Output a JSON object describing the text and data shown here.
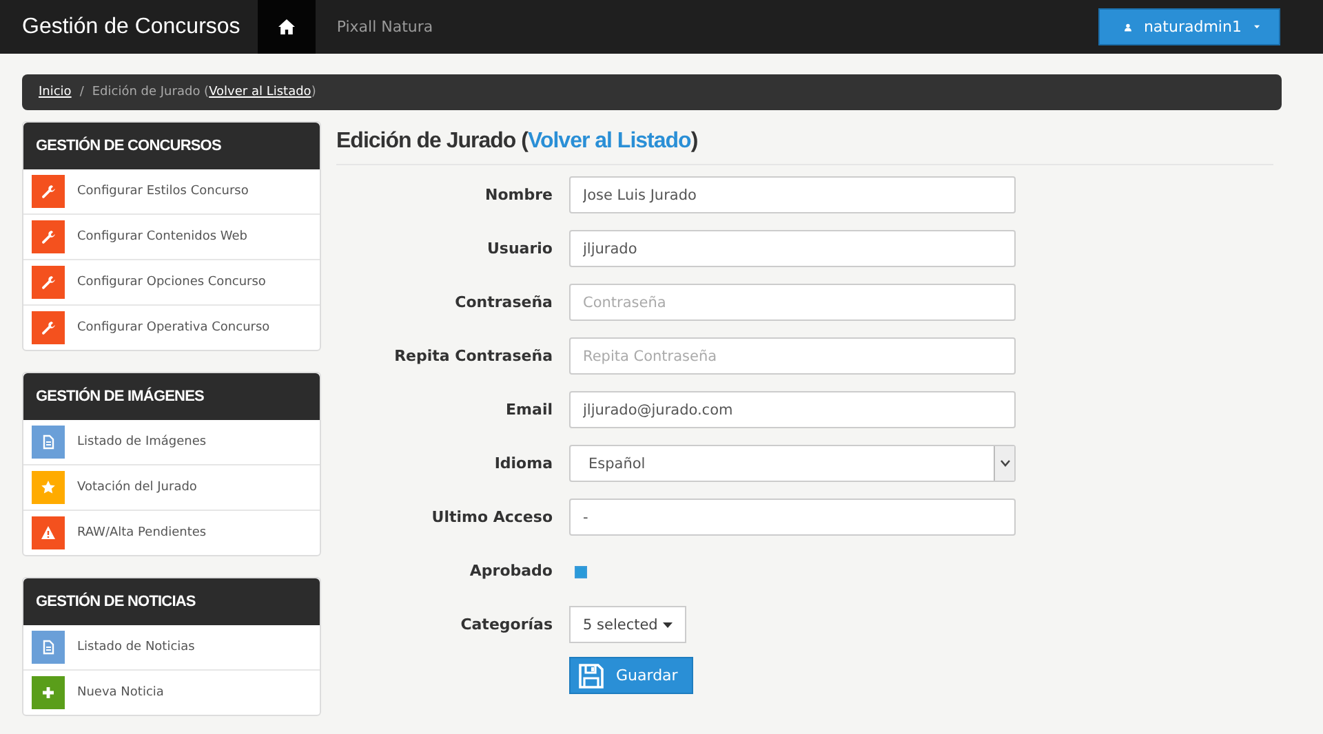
{
  "navbar": {
    "brand": "Gestión de Concursos",
    "home_selected": true,
    "links": [
      {
        "label": "Pixall Natura",
        "selected": false
      }
    ],
    "user": "naturadmin1"
  },
  "breadcrumb": {
    "home": "Inicio",
    "separator": "/",
    "current": "Edición de Jurado (",
    "link": "Volver al Listado",
    "tail": ")"
  },
  "sidebar": [
    {
      "title": "GESTIÓN DE CONCURSOS",
      "items": [
        {
          "label": "Configurar Estilos Concurso",
          "kind": "wrench",
          "color": "#f4511e"
        },
        {
          "label": "Configurar Contenidos Web",
          "kind": "wrench",
          "color": "#f4511e"
        },
        {
          "label": "Configurar Opciones Concurso",
          "kind": "wrench",
          "color": "#f4511e"
        },
        {
          "label": "Configurar Operativa Concurso",
          "kind": "wrench",
          "color": "#f4511e"
        }
      ]
    },
    {
      "title": "GESTIÓN DE IMÁGENES",
      "items": [
        {
          "label": "Listado de Imágenes",
          "kind": "document",
          "color": "#6a9fd8"
        },
        {
          "label": "Votación del Jurado",
          "kind": "star",
          "color": "#ffab00"
        },
        {
          "label": "RAW/Alta Pendientes",
          "kind": "warning",
          "color": "#f4511e"
        }
      ]
    },
    {
      "title": "GESTIÓN DE NOTICIAS",
      "items": [
        {
          "label": "Listado de Noticias",
          "kind": "document",
          "color": "#6a9fd8"
        },
        {
          "label": "Nueva Noticia",
          "kind": "plus",
          "color": "#5a9e1a"
        }
      ]
    }
  ],
  "form": {
    "title": "Edición de Jurado (",
    "title_link": "Volver al Listado",
    "title_tail": ")",
    "fields": [
      {
        "label": "Nombre",
        "kind": "text",
        "value": "Jose Luis Jurado"
      },
      {
        "label": "Usuario",
        "kind": "text",
        "value": "jljurado"
      },
      {
        "label": "Contraseña",
        "kind": "text",
        "placeholder": "Contraseña"
      },
      {
        "label": "Repita Contraseña",
        "kind": "text",
        "placeholder": "Repita Contraseña"
      },
      {
        "label": "Email",
        "kind": "text",
        "value": "jljurado@jurado.com"
      },
      {
        "label": "Idioma",
        "kind": "select",
        "value": "Español"
      },
      {
        "label": "Ultimo Acceso",
        "kind": "text",
        "value": "-"
      },
      {
        "label": "Aprobado",
        "kind": "checkbox",
        "checked": true
      },
      {
        "label": "Categorías",
        "kind": "multiselect",
        "value": "5 selected"
      }
    ],
    "save_button": "Guardar"
  }
}
